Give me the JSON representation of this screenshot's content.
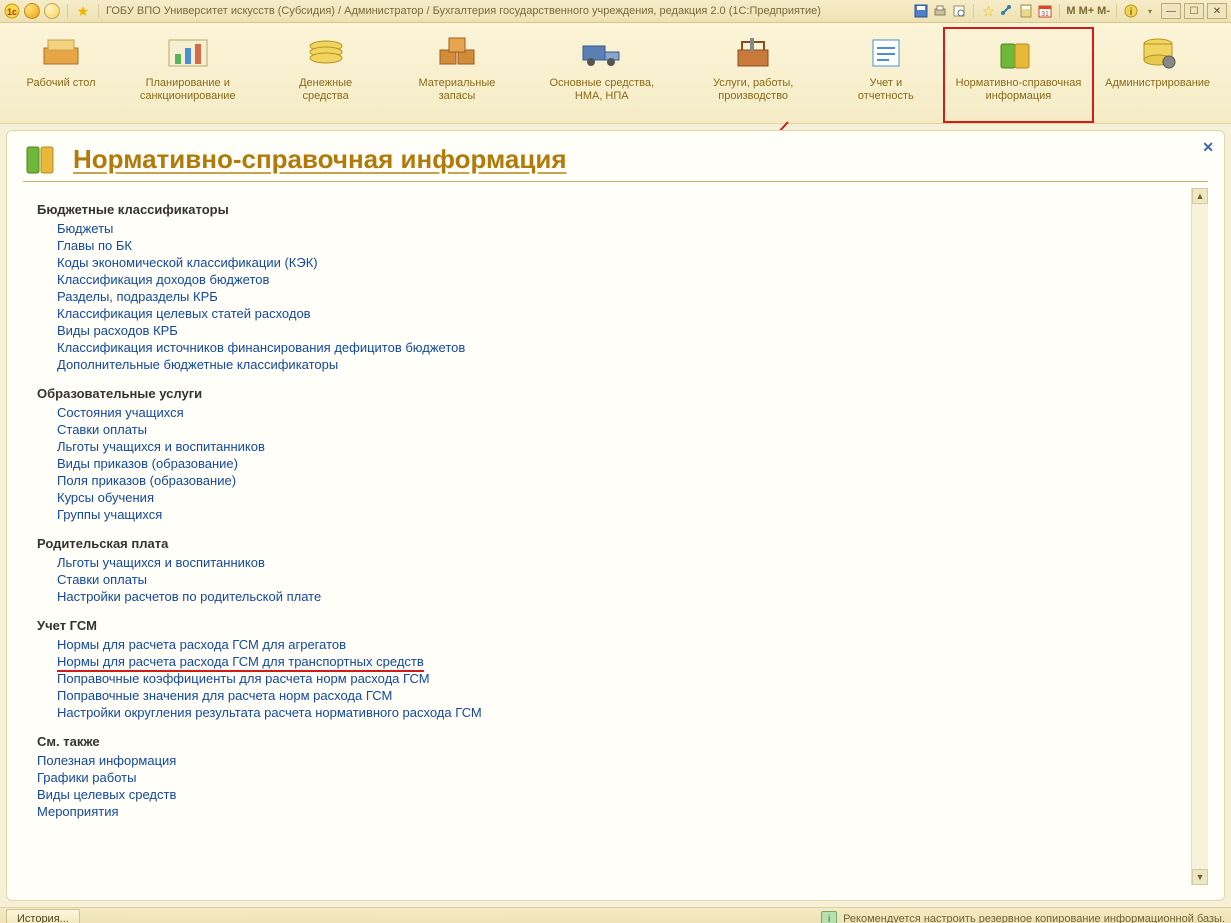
{
  "title": "ГОБУ ВПО Университет искусств (Субсидия) / Администратор / Бухгалтерия государственного учреждения, редакция 2.0  (1С:Предприятие)",
  "titlebar_right": {
    "m": "M",
    "mplus": "M+",
    "mminus": "M-"
  },
  "sections": [
    {
      "label": "Рабочий стол"
    },
    {
      "label": "Планирование и санкционирование"
    },
    {
      "label": "Денежные средства"
    },
    {
      "label": "Материальные запасы"
    },
    {
      "label": "Основные средства, НМА, НПА"
    },
    {
      "label": "Услуги, работы, производство"
    },
    {
      "label": "Учет и отчетность"
    },
    {
      "label": "Нормативно-справочная информация",
      "active": true
    },
    {
      "label": "Администрирование"
    }
  ],
  "page": {
    "heading": "Нормативно-справочная информация",
    "groups": [
      {
        "title": "Бюджетные классификаторы",
        "links": [
          "Бюджеты",
          "Главы по БК",
          "Коды экономической классификации (КЭК)",
          "Классификация доходов бюджетов",
          "Разделы, подразделы КРБ",
          "Классификация целевых статей расходов",
          "Виды расходов КРБ",
          "Классификация источников финансирования дефицитов бюджетов",
          "Дополнительные бюджетные классификаторы"
        ]
      },
      {
        "title": "Образовательные услуги",
        "links": [
          "Состояния учащихся",
          "Ставки оплаты",
          "Льготы учащихся и воспитанников",
          "Виды приказов (образование)",
          "Поля приказов (образование)",
          "Курсы обучения",
          "Группы учащихся"
        ]
      },
      {
        "title": "Родительская плата",
        "links": [
          "Льготы учащихся и воспитанников",
          "Ставки оплаты",
          "Настройки расчетов по родительской плате"
        ]
      },
      {
        "title": "Учет ГСМ",
        "links": [
          "Нормы для расчета расхода ГСМ для агрегатов",
          "Нормы для расчета расхода ГСМ для транспортных средств",
          "Поправочные коэффициенты для расчета норм расхода ГСМ",
          "Поправочные значения для расчета норм расхода ГСМ",
          "Настройки округления результата расчета нормативного расхода ГСМ"
        ]
      },
      {
        "title": "См. также",
        "see_also": true,
        "links": [
          "Полезная информация",
          "Графики работы",
          "Виды целевых средств",
          "Мероприятия"
        ]
      }
    ]
  },
  "footer": {
    "history": "История...",
    "hint": "Рекомендуется настроить резервное копирование информационной базы."
  }
}
